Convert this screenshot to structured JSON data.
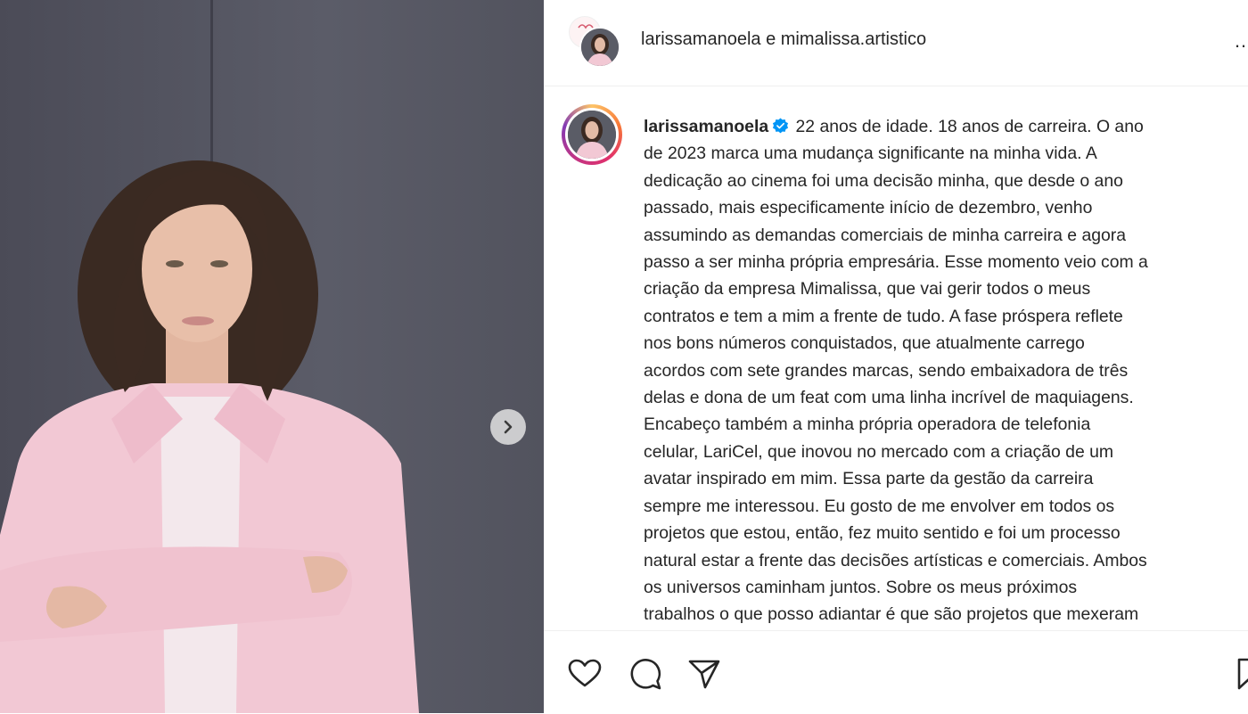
{
  "post": {
    "header_title": "larissamanoela e mimalissa.artistico",
    "more_label": "…",
    "icons": {
      "next": "chevron-right-icon",
      "like": "heart-icon",
      "comment": "comment-icon",
      "share": "send-icon",
      "save": "bookmark-icon",
      "verified": "verified-badge-icon"
    },
    "colors": {
      "verified": "#0095f6",
      "story_ring": "#e1306c",
      "text": "#262626"
    }
  },
  "caption": {
    "username": "larissamanoela",
    "first_line_rest": " 22 anos de idade. 18 anos de carreira. O ano",
    "lines": [
      "de 2023 marca uma mudança significante na minha vida. A",
      "dedicação ao cinema foi uma decisão minha, que desde o ano",
      "passado, mais especificamente início de dezembro, venho",
      "assumindo as demandas comerciais de minha carreira e agora",
      "passo a ser minha própria empresária. Esse momento veio com a",
      "criação da empresa Mimalissa, que vai gerir todos o meus",
      "contratos e tem a mim a frente de tudo. A fase próspera reflete",
      "nos bons números conquistados, que atualmente carrego",
      "acordos com sete grandes marcas, sendo embaixadora de três",
      "delas e dona de um feat com uma linha incrível de maquiagens.",
      "Encabeço também a minha própria operadora de telefonia",
      "celular, LariCel, que inovou no mercado com a criação de um",
      "avatar inspirado em mim. Essa parte da gestão da carreira",
      "sempre me interessou. Eu gosto de me envolver em todos os",
      "projetos que estou, então, fez muito sentido e foi um processo",
      "natural estar a frente das decisões artísticas e comerciais. Ambos",
      "os universos caminham juntos. Sobre os meus próximos",
      "trabalhos o que posso adiantar é que são projetos que mexeram"
    ]
  }
}
